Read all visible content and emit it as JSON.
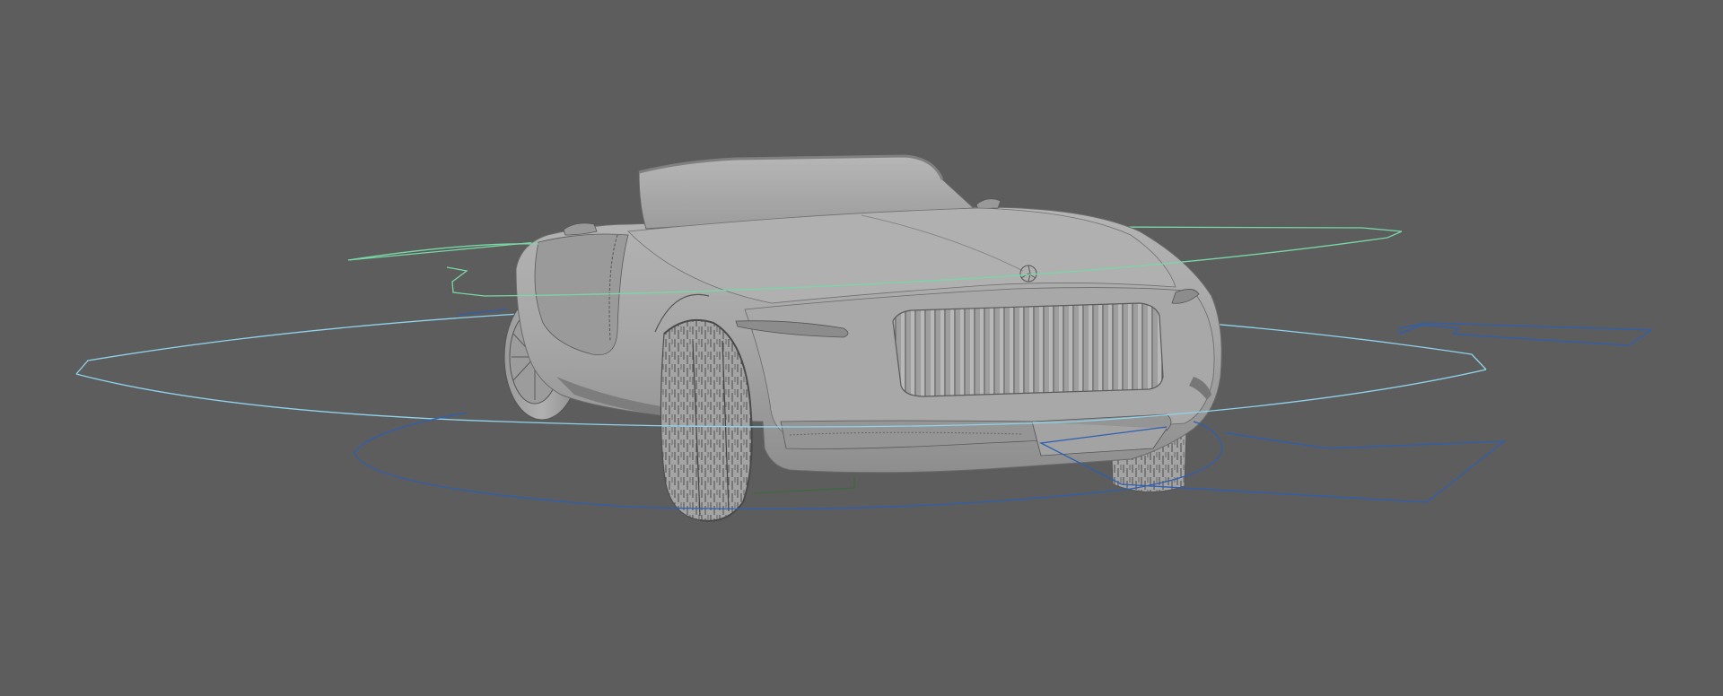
{
  "viewport": {
    "background_color": "#5d5d5d",
    "model_color": "#a9a9a9",
    "model_shadow_color": "#8a8a8a",
    "rig_curve_colors": {
      "cyan": "#8fd3ec",
      "green": "#79d7a6",
      "blue": "#2f5fb0"
    }
  },
  "scene_objects": [
    {
      "name": "car-body-model",
      "kind": "polygon-mesh"
    },
    {
      "name": "rig-control-upper",
      "kind": "nurbs-curve",
      "color": "green"
    },
    {
      "name": "rig-control-middle",
      "kind": "nurbs-curve",
      "color": "cyan"
    },
    {
      "name": "rig-control-lower",
      "kind": "nurbs-curve",
      "color": "blue"
    },
    {
      "name": "rig-control-right-arrow",
      "kind": "nurbs-curve",
      "color": "blue"
    }
  ]
}
